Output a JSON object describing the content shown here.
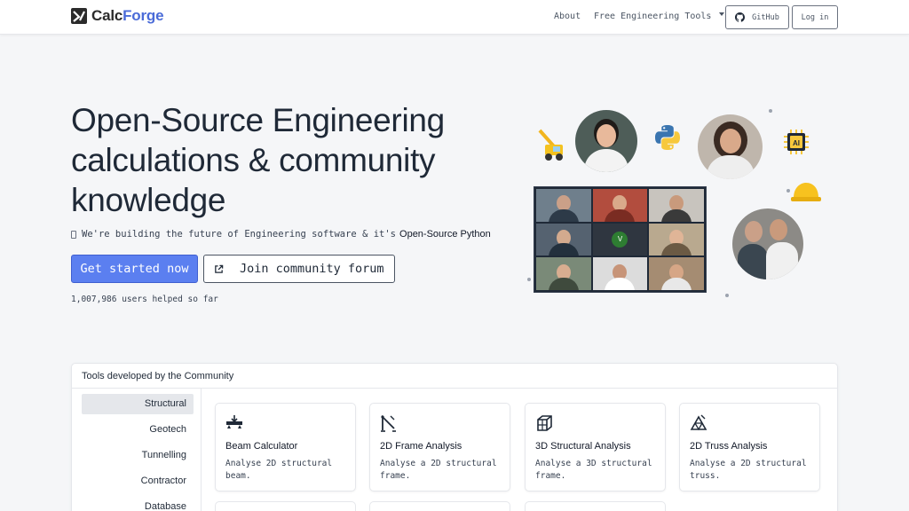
{
  "brand": {
    "calc": "Calc",
    "forge": "Forge"
  },
  "nav": {
    "about": "About",
    "tools": "Free Engineering Tools",
    "github": "GitHub",
    "login": "Log in"
  },
  "hero": {
    "title": "Open-Source Engineering calculations & community knowledge",
    "subtitle_prefix": "We're building the future of Engineering software & it's",
    "subtitle_strong": "Open-Source Python",
    "cta_primary": "Get started now",
    "cta_secondary": "Join community forum",
    "users_helped": "1,007,986 users helped so far"
  },
  "illustration": {
    "grid_center_initial": "V"
  },
  "tools_panel": {
    "title": "Tools developed by the Community",
    "categories": [
      {
        "label": "Structural",
        "active": true
      },
      {
        "label": "Geotech",
        "active": false
      },
      {
        "label": "Tunnelling",
        "active": false
      },
      {
        "label": "Contractor",
        "active": false
      },
      {
        "label": "Database",
        "active": false
      }
    ],
    "cards": [
      {
        "title": "Beam Calculator",
        "desc": "Analyse 2D structural beam.",
        "icon": "beam-icon"
      },
      {
        "title": "2D Frame Analysis",
        "desc": "Analyse a 2D structural frame.",
        "icon": "frame-icon"
      },
      {
        "title": "3D Structural Analysis",
        "desc": "Analyse a 3D structural frame.",
        "icon": "cube-frame-icon"
      },
      {
        "title": "2D Truss Analysis",
        "desc": "Analyse a 2D structural truss.",
        "icon": "truss-icon"
      }
    ]
  },
  "colors": {
    "accent": "#5b7ff0",
    "brand_blue": "#4a6bd8",
    "background": "#f5f6f8"
  }
}
